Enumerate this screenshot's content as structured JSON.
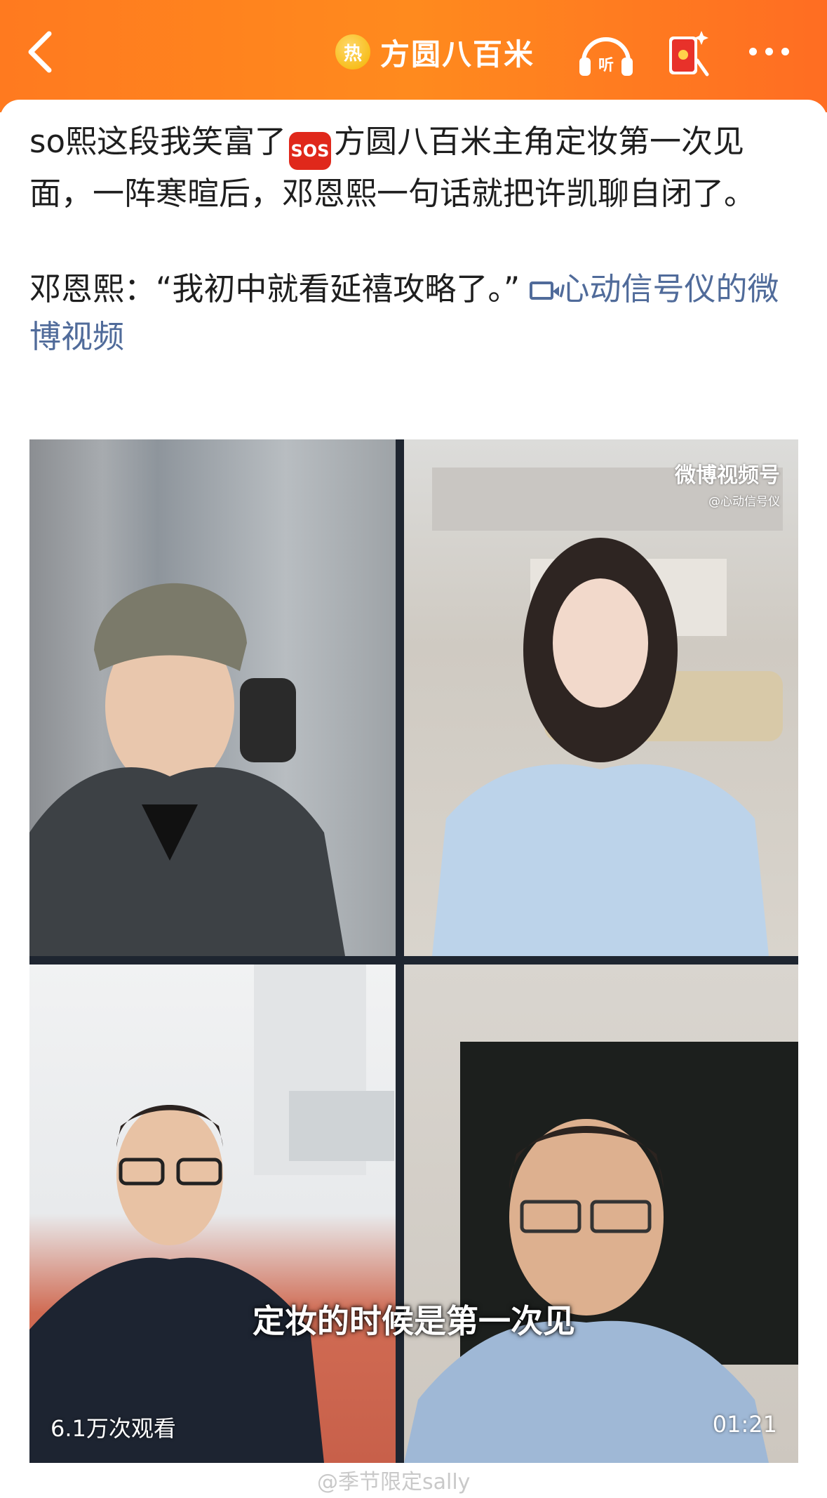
{
  "header": {
    "title": "方圆八百米",
    "hot_badge": "热",
    "listen_label": "听",
    "colors": {
      "bar": "#ff7a1f",
      "text": "#ffffff"
    }
  },
  "post": {
    "line1_before": "so熙这段我笑富了",
    "emoji": "SOS",
    "line1_after": "方圆八百米主角定妆第一次见面，一阵寒暄后，邓恩熙一句话就把许凯聊自闭了。",
    "quote": "邓恩熙：“我初中就看延禧攻略了。”",
    "link": "心动信号仪的微博视频",
    "link_color": "#506b9a"
  },
  "video": {
    "watermark_main": "微博视频号",
    "watermark_sub": "@心动信号仪",
    "subtitle": "定妆的时候是第一次见",
    "views": "6.1万次观看",
    "duration": "01:21"
  },
  "footer": {
    "user_watermark": "@季节限定sally"
  }
}
